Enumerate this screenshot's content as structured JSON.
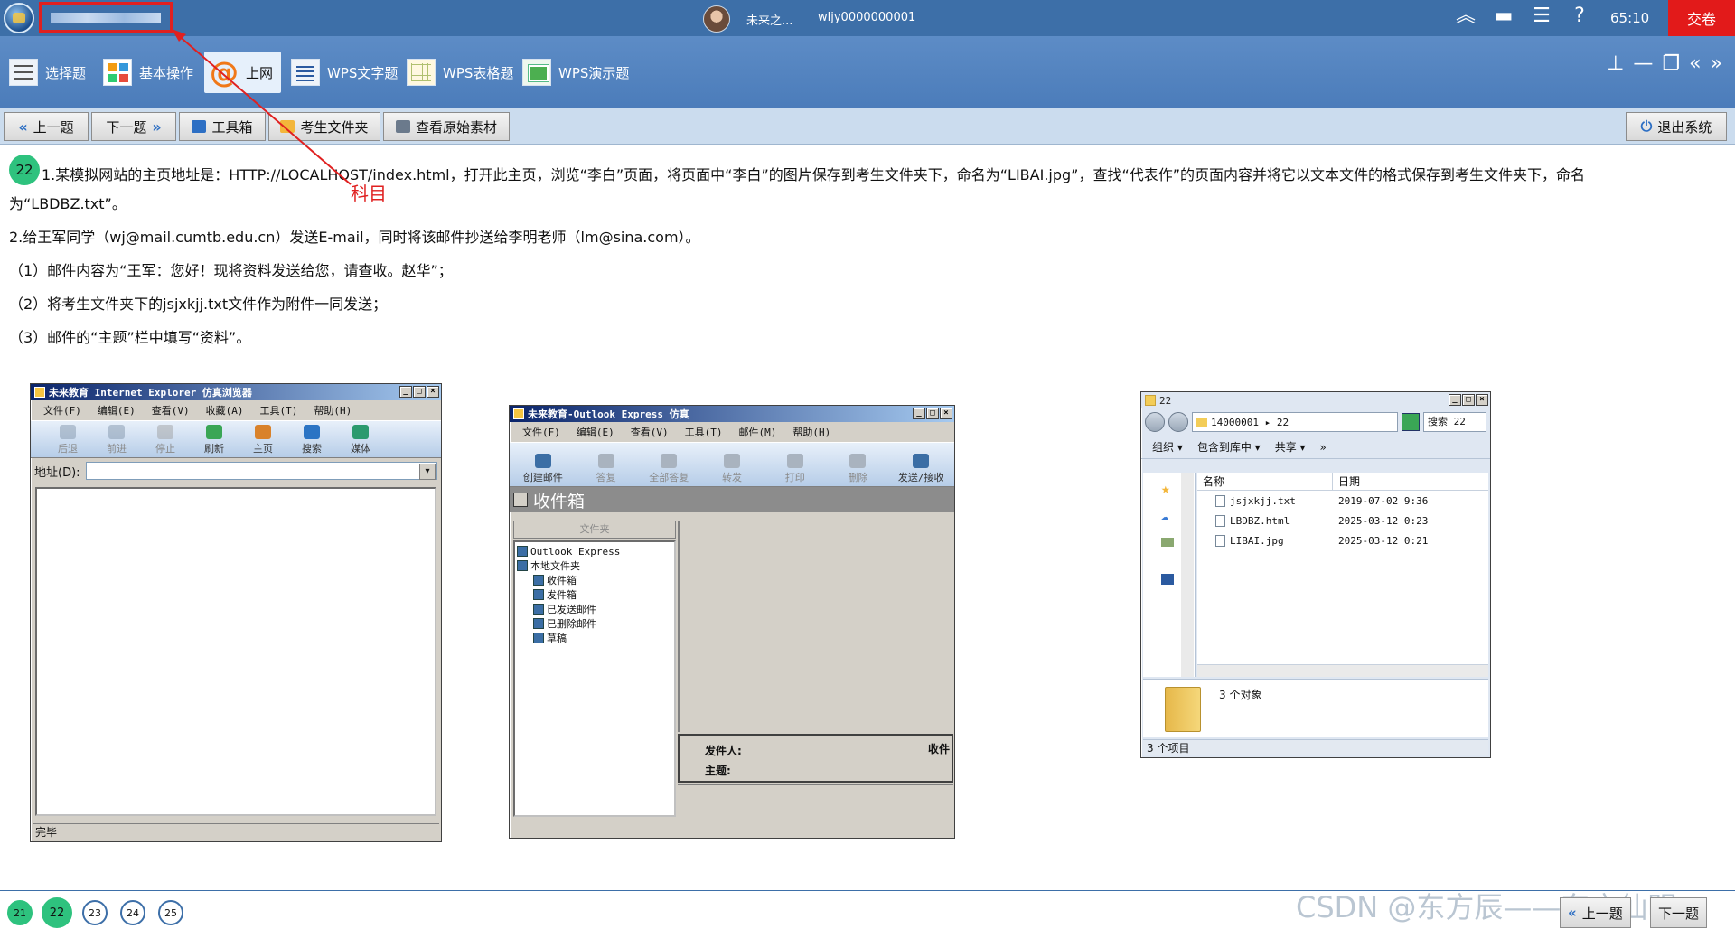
{
  "titlebar": {
    "username": "未来之...",
    "user_id": "wljy0000000001",
    "timer": "65:10",
    "submit_label": "交卷"
  },
  "tabs": [
    {
      "label": "选择题",
      "icon": "list-icon"
    },
    {
      "label": "基本操作",
      "icon": "grid-icon"
    },
    {
      "label": "上网",
      "icon": "at-icon"
    },
    {
      "label": "WPS文字题",
      "icon": "document-icon"
    },
    {
      "label": "WPS表格题",
      "icon": "spreadsheet-icon"
    },
    {
      "label": "WPS演示题",
      "icon": "presentation-icon"
    }
  ],
  "navbar": {
    "prev": "上一题",
    "next": "下一题",
    "toolbox": "工具箱",
    "student_folder": "考生文件夹",
    "view_source": "查看原始素材",
    "exit": "退出系统"
  },
  "question": {
    "number": "22",
    "line1": "1.某模拟网站的主页地址是：HTTP://LOCALHOST/index.html，打开此主页，浏览“李白”页面，将页面中“李白”的图片保存到考生文件夹下，命名为“LIBAI.jpg”，查找“代表作”的页面内容并将它以文本文件的格式保存到考生文件夹下，命名",
    "line1b": "为“LBDBZ.txt”。",
    "line2": "2.给王军同学（wj@mail.cumtb.edu.cn）发送E-mail，同时将该邮件抄送给李明老师（lm@sina.com）。",
    "line3": "（1）邮件内容为“王军：您好！现将资料发送给您，请查收。赵华”；",
    "line4": "（2）将考生文件夹下的jsjxkjj.txt文件作为附件一同发送；",
    "line5": "（3）邮件的“主题”栏中填写“资料”。"
  },
  "annotation": {
    "label": "科目"
  },
  "ie": {
    "title": "未来教育 Internet Explorer 仿真浏览器",
    "menu": [
      "文件(F)",
      "编辑(E)",
      "查看(V)",
      "收藏(A)",
      "工具(T)",
      "帮助(H)"
    ],
    "toolbar": [
      {
        "label": "后退",
        "disabled": true
      },
      {
        "label": "前进",
        "disabled": true
      },
      {
        "label": "停止",
        "disabled": true
      },
      {
        "label": "刷新",
        "disabled": false
      },
      {
        "label": "主页",
        "disabled": false
      },
      {
        "label": "搜索",
        "disabled": false
      },
      {
        "label": "媒体",
        "disabled": false
      }
    ],
    "address_label": "地址(D):",
    "address_value": "",
    "status": "完毕"
  },
  "oe": {
    "title": "未来教育-Outlook Express 仿真",
    "menu": [
      "文件(F)",
      "编辑(E)",
      "查看(V)",
      "工具(T)",
      "邮件(M)",
      "帮助(H)"
    ],
    "toolbar": [
      {
        "label": "创建邮件",
        "disabled": false
      },
      {
        "label": "答复",
        "disabled": true
      },
      {
        "label": "全部答复",
        "disabled": true
      },
      {
        "label": "转发",
        "disabled": true
      },
      {
        "label": "打印",
        "disabled": true
      },
      {
        "label": "删除",
        "disabled": true
      },
      {
        "label": "发送/接收",
        "disabled": false
      }
    ],
    "inbox_title": "收件箱",
    "folder_header": "文件夹",
    "folders": [
      "Outlook Express",
      "本地文件夹",
      "收件箱",
      "发件箱",
      "已发送邮件",
      "已删除邮件",
      "草稿"
    ],
    "preview_from": "发件人:",
    "preview_to": "收件",
    "preview_subject": "主题:"
  },
  "explorer": {
    "title": "22",
    "path": "14000001 ▸ 22",
    "search": "搜索 22",
    "commands": [
      "组织 ▾",
      "包含到库中 ▾",
      "共享 ▾",
      "»"
    ],
    "col_name": "名称",
    "col_date": "日期",
    "files": [
      {
        "name": "jsjxkjj.txt",
        "date": "2019-07-02 9:36"
      },
      {
        "name": "LBDBZ.html",
        "date": "2025-03-12 0:23"
      },
      {
        "name": "LIBAI.jpg",
        "date": "2025-03-12 0:21"
      }
    ],
    "object_count": "3 个对象",
    "status": "3 个项目"
  },
  "pager": {
    "pages": [
      "21",
      "22",
      "23",
      "24",
      "25"
    ],
    "current": "22"
  },
  "bottom_nav": {
    "prev": "上一题",
    "next": "下一题"
  },
  "watermark": "CSDN @东方辰——东方仙明",
  "colors": {
    "titlebar": "#3d6fa8",
    "tabbar": "#5d8cc6",
    "submit": "#e21a1a",
    "page_done": "#2ec27e",
    "annotation": "#e02020"
  }
}
